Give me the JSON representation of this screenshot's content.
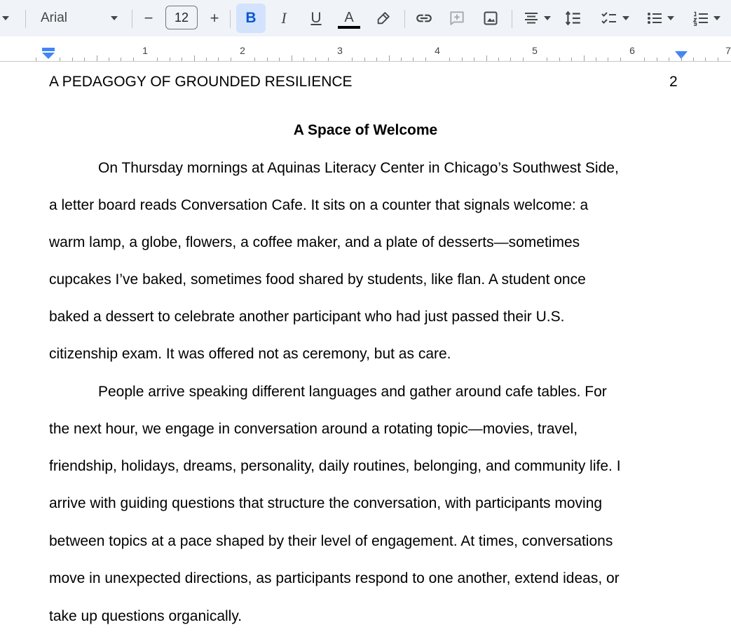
{
  "toolbar": {
    "font": "Arial",
    "font_size": "12",
    "decrease_label": "−",
    "increase_label": "+",
    "bold_label": "B",
    "italic_label": "I",
    "underline_label": "U",
    "text_color_label": "A",
    "icons": [
      "chevron-down",
      "pencil-highlight",
      "link",
      "add-comment",
      "insert-image",
      "align-center",
      "line-spacing",
      "checklist",
      "bulleted-list",
      "numbered-list"
    ],
    "accent_color": "#d3e3fd"
  },
  "ruler": {
    "numbers": [
      "1",
      "2",
      "3",
      "4",
      "5",
      "6",
      "7"
    ],
    "marker_color": "#4285f4"
  },
  "document": {
    "header_title": "A PEDAGOGY OF GROUNDED RESILIENCE",
    "page_number": "2",
    "heading": "A Space of Welcome",
    "lines": [
      "On Thursday mornings at Aquinas Literacy Center in Chicago’s Southwest Side,",
      "a letter board reads Conversation Cafe. It sits on a counter that signals welcome: a",
      "warm lamp, a globe, flowers, a coffee maker, and a plate of desserts—sometimes",
      "cupcakes I’ve baked, sometimes food shared by students, like flan. A student once",
      "baked a dessert to celebrate another participant who had just passed their U.S.",
      "citizenship exam. It was offered not as ceremony, but as care.",
      "People arrive speaking different languages and gather around cafe tables. For",
      "the next hour, we engage in conversation around a rotating topic—movies, travel,",
      "friendship, holidays, dreams, personality, daily routines, belonging, and community life. I",
      "arrive with guiding questions that structure the conversation, with participants moving",
      "between topics at a pace shaped by their level of engagement. At times, conversations",
      "move in unexpected directions, as participants respond to one another, extend ideas, or",
      "take up questions organically."
    ]
  }
}
